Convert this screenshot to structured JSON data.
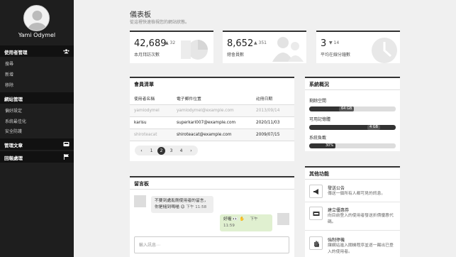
{
  "sidebar": {
    "username": "Yami Odymel",
    "sections": [
      {
        "title": "使用者管理",
        "icon": "users-icon",
        "items": [
          "搜尋",
          "新增",
          "移除"
        ]
      },
      {
        "title": "網站管理",
        "items": [
          "偏好設定",
          "系統最佳化",
          "安全防護"
        ]
      },
      {
        "title": "管理文章",
        "icon": "inbox-icon"
      },
      {
        "title": "回報處理",
        "icon": "flag-icon"
      }
    ]
  },
  "header": {
    "title": "儀表板",
    "subtitle": "從這裡快速檢視您的網站狀態。"
  },
  "stats": [
    {
      "value": "42,689",
      "delta": "32",
      "label": "本月拜訪次數",
      "icon": "chart-pie-icon"
    },
    {
      "value": "8,652",
      "delta": "351",
      "label": "總會員數",
      "icon": "users-icon"
    },
    {
      "value": "3",
      "delta": "14",
      "label": "平均在線分鐘數",
      "icon": "clock-icon"
    }
  ],
  "members": {
    "title": "會員清單",
    "columns": [
      "使用者名稱",
      "電子郵件位置",
      "註冊日期"
    ],
    "rows": [
      [
        "yamiodymel",
        "yamiodymel@example.com",
        "2013/09/14"
      ],
      [
        "karisu",
        "superkari007@example.com",
        "2020/11/03"
      ],
      [
        "shiroteacat",
        "shiroteacat@example.com",
        "2009/07/15"
      ]
    ],
    "pages": [
      "1",
      "2",
      "3",
      "4"
    ],
    "active_page": "2"
  },
  "system": {
    "title": "系統概況",
    "bars": [
      {
        "label": "剩餘空間",
        "value": "64 GB",
        "fraction": 1.0
      },
      {
        "label": "可用記憶體",
        "value": "4 GB",
        "fraction": 1.0
      },
      {
        "label": "系統負載",
        "value": "30%",
        "fraction": 0.3
      }
    ]
  },
  "chat": {
    "title": "留言板",
    "messages": [
      {
        "text1": "不要到處亂刪使用者的留言，",
        "text2": "你是槌到嗎喵 😉",
        "time": "下午 11:58"
      },
      {
        "text": "好喔 👀 ✋",
        "time": "下午 11:59"
      }
    ],
    "placeholder": "輸入訊息⋯"
  },
  "functions": {
    "title": "其他功能",
    "items": [
      {
        "title": "發送公告",
        "desc": "傳送一個所有人都可見的訊息。",
        "icon": "megaphone-icon"
      },
      {
        "title": "建立優惠券",
        "desc": "向目前登入的使用者發送折價優惠代碼。",
        "icon": "coupon-icon"
      },
      {
        "title": "強制停機",
        "desc": "讓網站進入關機程序並逐一踢出已登入的使用者。",
        "icon": "hand-icon"
      }
    ]
  }
}
